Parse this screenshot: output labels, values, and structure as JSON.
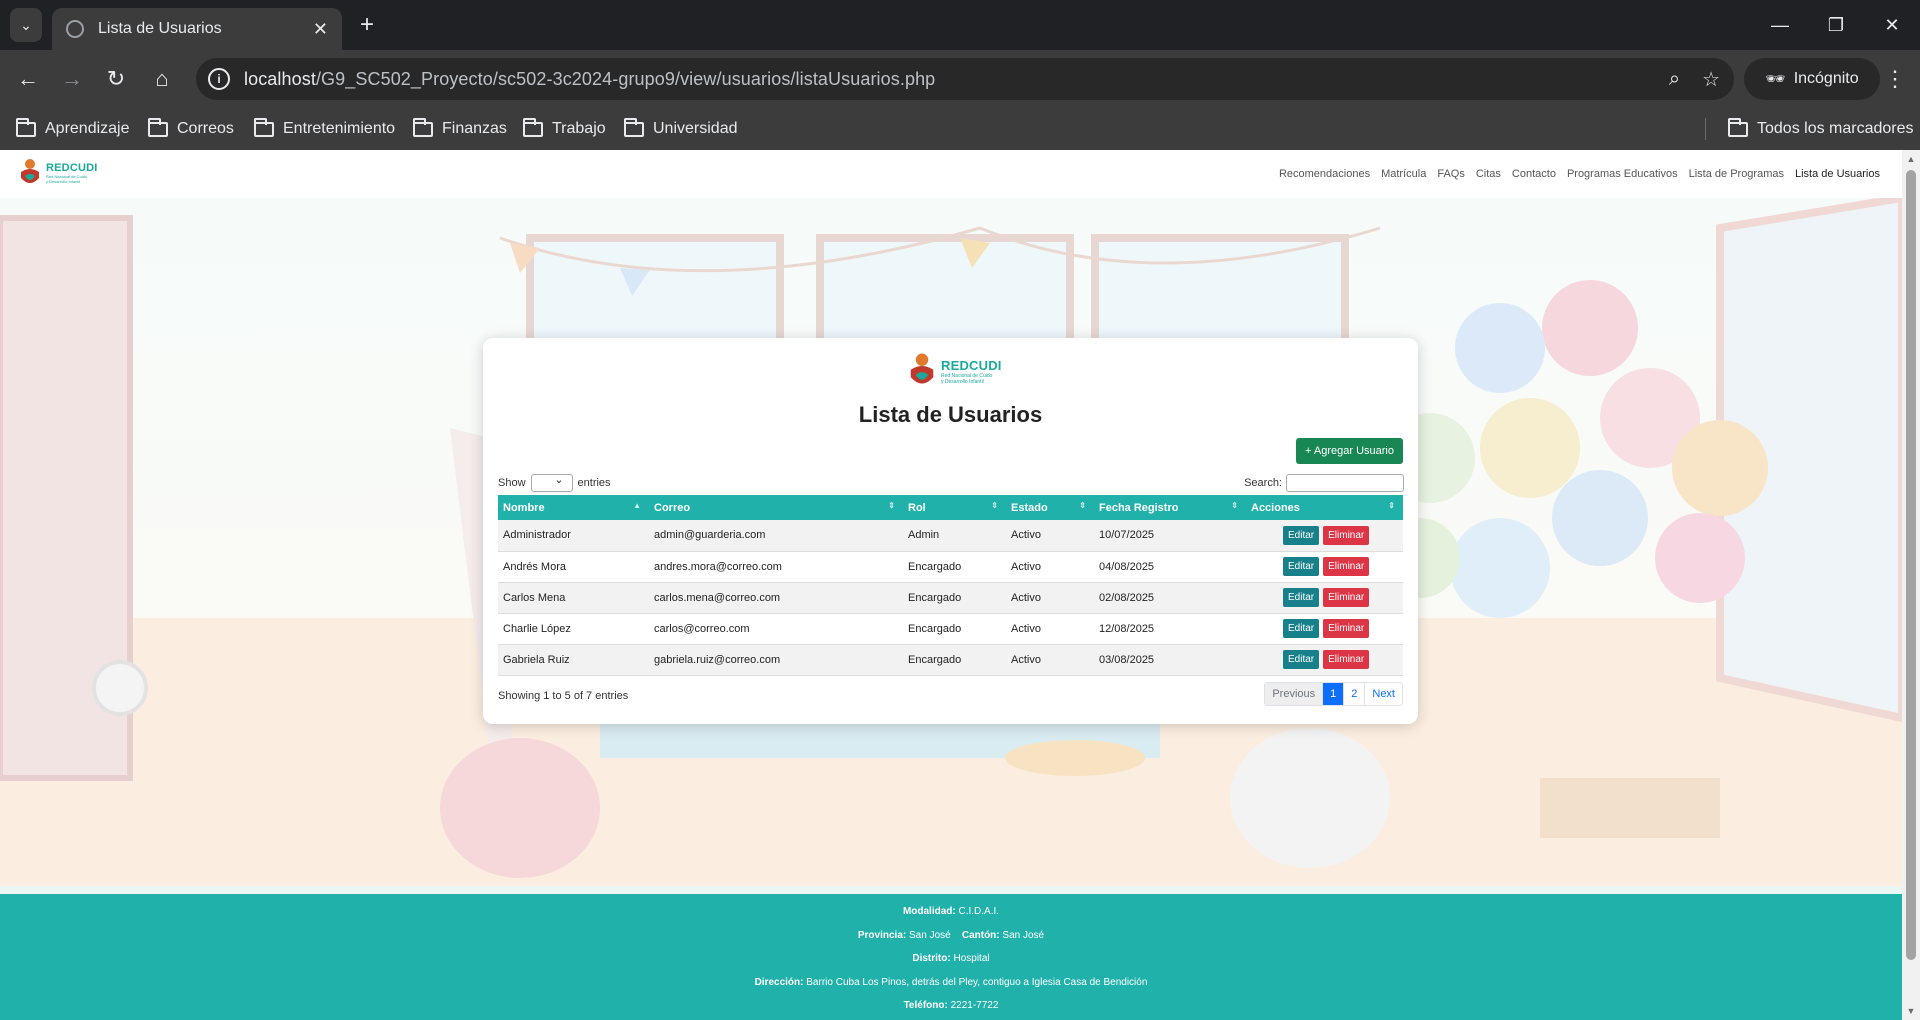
{
  "browser": {
    "tab_title": "Lista de Usuarios",
    "url_host": "localhost",
    "url_path": "/G9_SC502_Proyecto/sc502-3c2024-grupo9/view/usuarios/listaUsuarios.php",
    "incognito_label": "Incógnito",
    "bookmarks": [
      "Aprendizaje",
      "Correos",
      "Entretenimiento",
      "Finanzas",
      "Trabajo",
      "Universidad"
    ],
    "all_bookmarks_label": "Todos los marcadores"
  },
  "site": {
    "brand_name": "REDCUDI",
    "brand_sub_1": "Red Nacional de Cuido",
    "brand_sub_2": "y Desarrollo Infantil",
    "nav": [
      "Recomendaciones",
      "Matrícula",
      "FAQs",
      "Citas",
      "Contacto",
      "Programas Educativos",
      "Lista de Programas",
      "Lista de Usuarios"
    ],
    "active_nav": "Lista de Usuarios"
  },
  "card": {
    "title": "Lista de Usuarios",
    "add_button": "+ Agregar Usuario",
    "show_label": "Show",
    "entries_label": "entries",
    "search_label": "Search:",
    "columns": [
      "Nombre",
      "Correo",
      "Rol",
      "Estado",
      "Fecha Registro",
      "Acciones"
    ],
    "rows": [
      {
        "nombre": "Administrador",
        "correo": "admin@guarderia.com",
        "rol": "Admin",
        "estado": "Activo",
        "fecha": "10/07/2025"
      },
      {
        "nombre": "Andrés Mora",
        "correo": "andres.mora@correo.com",
        "rol": "Encargado",
        "estado": "Activo",
        "fecha": "04/08/2025"
      },
      {
        "nombre": "Carlos Mena",
        "correo": "carlos.mena@correo.com",
        "rol": "Encargado",
        "estado": "Activo",
        "fecha": "02/08/2025"
      },
      {
        "nombre": "Charlie López",
        "correo": "carlos@correo.com",
        "rol": "Encargado",
        "estado": "Activo",
        "fecha": "12/08/2025"
      },
      {
        "nombre": "Gabriela Ruiz",
        "correo": "gabriela.ruiz@correo.com",
        "rol": "Encargado",
        "estado": "Activo",
        "fecha": "03/08/2025"
      }
    ],
    "edit_label": "Editar",
    "delete_label": "Eliminar",
    "showing_text": "Showing 1 to 5 of 7 entries",
    "pager": {
      "previous": "Previous",
      "page1": "1",
      "page2": "2",
      "next": "Next"
    }
  },
  "footer": {
    "modalidad_label": "Modalidad:",
    "modalidad": "C.I.D.A.I.",
    "provincia_label": "Provincia:",
    "provincia": "San José",
    "canton_label": "Cantón:",
    "canton": "San José",
    "distrito_label": "Distrito:",
    "distrito": "Hospital",
    "direccion_label": "Dirección:",
    "direccion": "Barrio Cuba Los Pinos, detrás del Pley, contiguo a Iglesia Casa de Bendición",
    "telefono_label": "Teléfono:",
    "telefono": "2221-7722"
  },
  "colors": {
    "teal": "#20b2aa",
    "add_green": "#198754",
    "delete_red": "#dc3545",
    "page_blue": "#0d6efd"
  }
}
